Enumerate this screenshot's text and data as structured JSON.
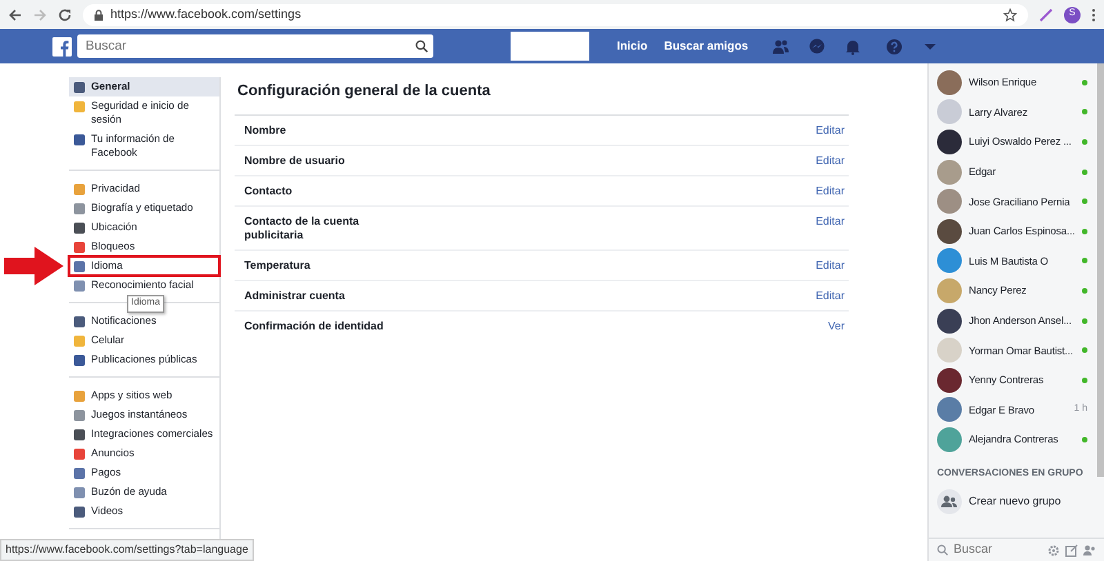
{
  "browser": {
    "url": "https://www.facebook.com/settings",
    "profile_initial": "S"
  },
  "header": {
    "search_placeholder": "Buscar",
    "nav": [
      "Inicio",
      "Buscar amigos"
    ]
  },
  "menu": [
    [
      {
        "label": "General",
        "selected": true,
        "highlighted": false
      },
      {
        "label": "Seguridad e inicio de sesión",
        "selected": false,
        "highlighted": false
      },
      {
        "label": "Tu información de Facebook",
        "selected": false,
        "highlighted": false
      }
    ],
    [
      {
        "label": "Privacidad",
        "selected": false,
        "highlighted": false
      },
      {
        "label": "Biografía y etiquetado",
        "selected": false,
        "highlighted": false
      },
      {
        "label": "Ubicación",
        "selected": false,
        "highlighted": false
      },
      {
        "label": "Bloqueos",
        "selected": false,
        "highlighted": false
      },
      {
        "label": "Idioma",
        "selected": false,
        "highlighted": true
      },
      {
        "label": "Reconocimiento facial",
        "selected": false,
        "highlighted": false
      }
    ],
    [
      {
        "label": "Notificaciones",
        "selected": false,
        "highlighted": false
      },
      {
        "label": "Celular",
        "selected": false,
        "highlighted": false
      },
      {
        "label": "Publicaciones públicas",
        "selected": false,
        "highlighted": false
      }
    ],
    [
      {
        "label": "Apps y sitios web",
        "selected": false,
        "highlighted": false
      },
      {
        "label": "Juegos instantáneos",
        "selected": false,
        "highlighted": false
      },
      {
        "label": "Integraciones comerciales",
        "selected": false,
        "highlighted": false
      },
      {
        "label": "Anuncios",
        "selected": false,
        "highlighted": false
      },
      {
        "label": "Pagos",
        "selected": false,
        "highlighted": false
      },
      {
        "label": "Buzón de ayuda",
        "selected": false,
        "highlighted": false
      },
      {
        "label": "Videos",
        "selected": false,
        "highlighted": false
      }
    ]
  ],
  "tooltip": "Idioma",
  "settings": {
    "title": "Configuración general de la cuenta",
    "rows": [
      {
        "label": "Nombre",
        "action": "Editar"
      },
      {
        "label": "Nombre de usuario",
        "action": "Editar"
      },
      {
        "label": "Contacto",
        "action": "Editar"
      },
      {
        "label": "Contacto de la cuenta publicitaria",
        "action": "Editar"
      },
      {
        "label": "Temperatura",
        "action": "Editar"
      },
      {
        "label": "Administrar cuenta",
        "action": "Editar"
      },
      {
        "label": "Confirmación de identidad",
        "action": "Ver"
      }
    ]
  },
  "chat": {
    "contacts": [
      {
        "name": "Wilson Enrique",
        "online": true
      },
      {
        "name": "Larry Alvarez",
        "online": true
      },
      {
        "name": "Luiyi Oswaldo Perez ...",
        "online": true
      },
      {
        "name": "Edgar",
        "online": true
      },
      {
        "name": "Jose Graciliano Pernia",
        "online": true
      },
      {
        "name": "Juan Carlos Espinosa...",
        "online": true
      },
      {
        "name": "Luis M Bautista O",
        "online": true
      },
      {
        "name": "Nancy Perez",
        "online": true
      },
      {
        "name": "Jhon Anderson Ansel...",
        "online": true
      },
      {
        "name": "Yorman Omar Bautist...",
        "online": true
      },
      {
        "name": "Yenny Contreras",
        "online": true
      },
      {
        "name": "Edgar E Bravo",
        "online": false,
        "last_active": "1 h"
      },
      {
        "name": "Alejandra Contreras",
        "online": true
      }
    ],
    "group_heading": "CONVERSACIONES EN GRUPO",
    "create_group": "Crear nuevo grupo",
    "search_placeholder": "Buscar"
  },
  "status_url": "https://www.facebook.com/settings?tab=language"
}
